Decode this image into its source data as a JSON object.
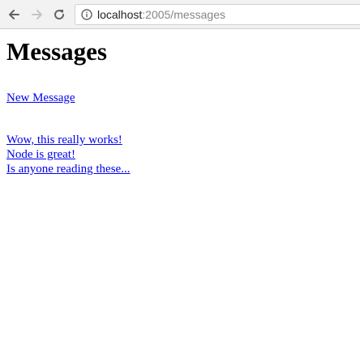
{
  "browser": {
    "url_host": "localhost",
    "url_rest": ":2005/messages"
  },
  "page": {
    "title": "Messages",
    "new_message_link": "New Message",
    "messages": [
      "Wow, this really works!",
      "Node is great!",
      "Is anyone reading these..."
    ]
  },
  "icons": {
    "back": "back-arrow-icon",
    "forward": "forward-arrow-icon",
    "reload": "reload-icon",
    "info": "info-icon"
  },
  "colors": {
    "link": "#0000ee",
    "toolbar_bg": "#f2f2f2",
    "url_host": "#202124",
    "url_rest": "#80868b"
  }
}
